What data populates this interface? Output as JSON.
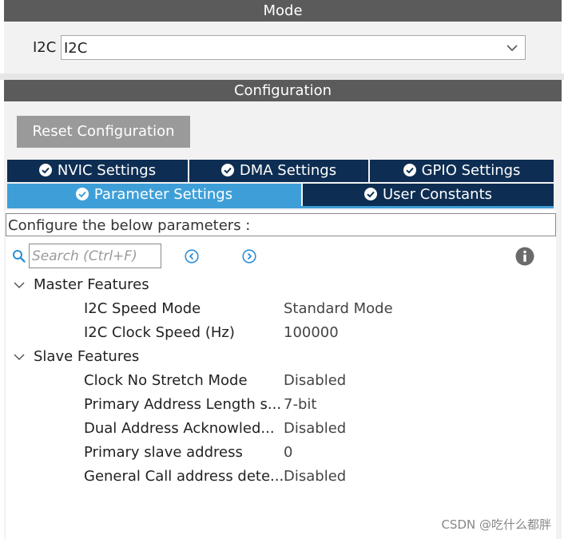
{
  "mode": {
    "header": "Mode",
    "field_label": "I2C",
    "selected_value": "I2C"
  },
  "configuration": {
    "header": "Configuration",
    "reset_label": "Reset Configuration",
    "tabs_row1": [
      {
        "label": "NVIC Settings"
      },
      {
        "label": "DMA Settings"
      },
      {
        "label": "GPIO Settings"
      }
    ],
    "tabs_row2": [
      {
        "label": "Parameter Settings",
        "active": true
      },
      {
        "label": "User Constants"
      }
    ],
    "configure_text": "Configure the below parameters :",
    "search_placeholder": "Search (Ctrl+F)"
  },
  "tree": {
    "groups": [
      {
        "label": "Master Features",
        "params": [
          {
            "name": "I2C Speed Mode",
            "value": "Standard Mode"
          },
          {
            "name": "I2C Clock Speed (Hz)",
            "value": "100000"
          }
        ]
      },
      {
        "label": "Slave Features",
        "params": [
          {
            "name": "Clock No Stretch Mode",
            "value": "Disabled"
          },
          {
            "name": "Primary Address Length s...",
            "value": "7-bit"
          },
          {
            "name": "Dual Address Acknowled...",
            "value": "Disabled"
          },
          {
            "name": "Primary slave address",
            "value": "0"
          },
          {
            "name": "General Call address dete...",
            "value": "Disabled"
          }
        ]
      }
    ]
  },
  "watermark": "CSDN @吃什么都胖",
  "colors": {
    "header_bg": "#5b5b5b",
    "tab_bg": "#0d2d52",
    "tab_active_bg": "#3e9fd8",
    "check_green": "#36b37e",
    "link_blue": "#2a8fd6"
  }
}
